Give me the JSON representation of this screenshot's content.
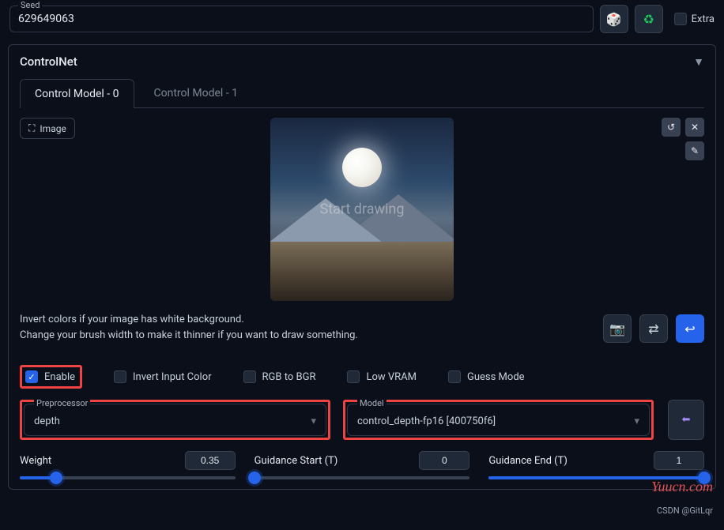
{
  "seed": {
    "label": "Seed",
    "value": "629649063"
  },
  "extra_label": "Extra",
  "panel_title": "ControlNet",
  "tabs": [
    {
      "label": "Control Model - 0",
      "active": true
    },
    {
      "label": "Control Model - 1",
      "active": false
    }
  ],
  "image_button": "Image",
  "overlay_text": "Start drawing",
  "help_line1": "Invert colors if your image has white background.",
  "help_line2": "Change your brush width to make it thinner if you want to draw something.",
  "checkboxes": {
    "enable": {
      "label": "Enable",
      "checked": true
    },
    "invert": {
      "label": "Invert Input Color",
      "checked": false
    },
    "rgb": {
      "label": "RGB to BGR",
      "checked": false
    },
    "vram": {
      "label": "Low VRAM",
      "checked": false
    },
    "guess": {
      "label": "Guess Mode",
      "checked": false
    }
  },
  "preprocessor": {
    "label": "Preprocessor",
    "value": "depth"
  },
  "model": {
    "label": "Model",
    "value": "control_depth-fp16 [400750f6]"
  },
  "sliders": {
    "weight": {
      "label": "Weight",
      "value": "0.35",
      "pct": 17
    },
    "gstart": {
      "label": "Guidance Start (T)",
      "value": "0",
      "pct": 0
    },
    "gend": {
      "label": "Guidance End (T)",
      "value": "1",
      "pct": 100
    }
  },
  "icons": {
    "dice": "🎲",
    "recycle": "♻",
    "image": "⛶",
    "undo": "↺",
    "close": "✕",
    "pen": "✎",
    "webcam": "📷",
    "swap": "⇄",
    "send": "↩",
    "chevron": "▾",
    "caret": "▼",
    "arrow_left": "⬅",
    "check": "✓"
  },
  "watermark_red": "Yuucn.com",
  "watermark_gray": "CSDN @GitLqr"
}
